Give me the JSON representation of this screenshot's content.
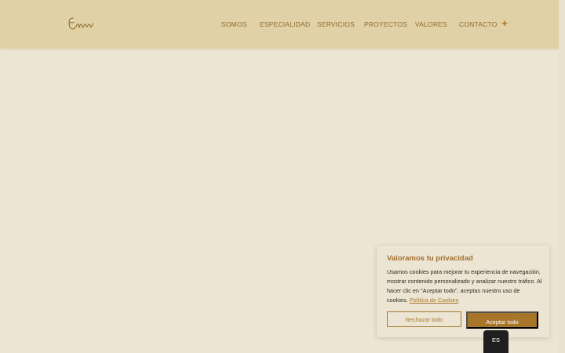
{
  "header": {
    "logo_text": "Emw",
    "nav": [
      "SOMOS",
      "ESPECIALIDAD",
      "SERVICIOS",
      "PROYECTOS",
      "VALORES",
      "CONTACTO"
    ],
    "menu_icon": "plus-icon",
    "menu_symbol": "+"
  },
  "cookie_banner": {
    "title": "Valoramos tu privacidad",
    "body": "Usamos cookies para mejorar tu experiencia de navegación, mostrar contenido personalizado y analizar nuestro tráfico. Al hacer clic en \"Aceptar todo\", aceptas nuestro uso de cookies.",
    "policy_link": "Política de Cookies",
    "reject_label": "Rechazar todo",
    "accept_label": "Aceptar todo"
  },
  "language": {
    "current": "ES"
  },
  "colors": {
    "page_bg": "#ece5d3",
    "header_bg": "#e1d1a6",
    "accent": "#a7762b",
    "nav_text": "#8d6a2f",
    "lang_tab_bg": "#1f1f1f"
  }
}
